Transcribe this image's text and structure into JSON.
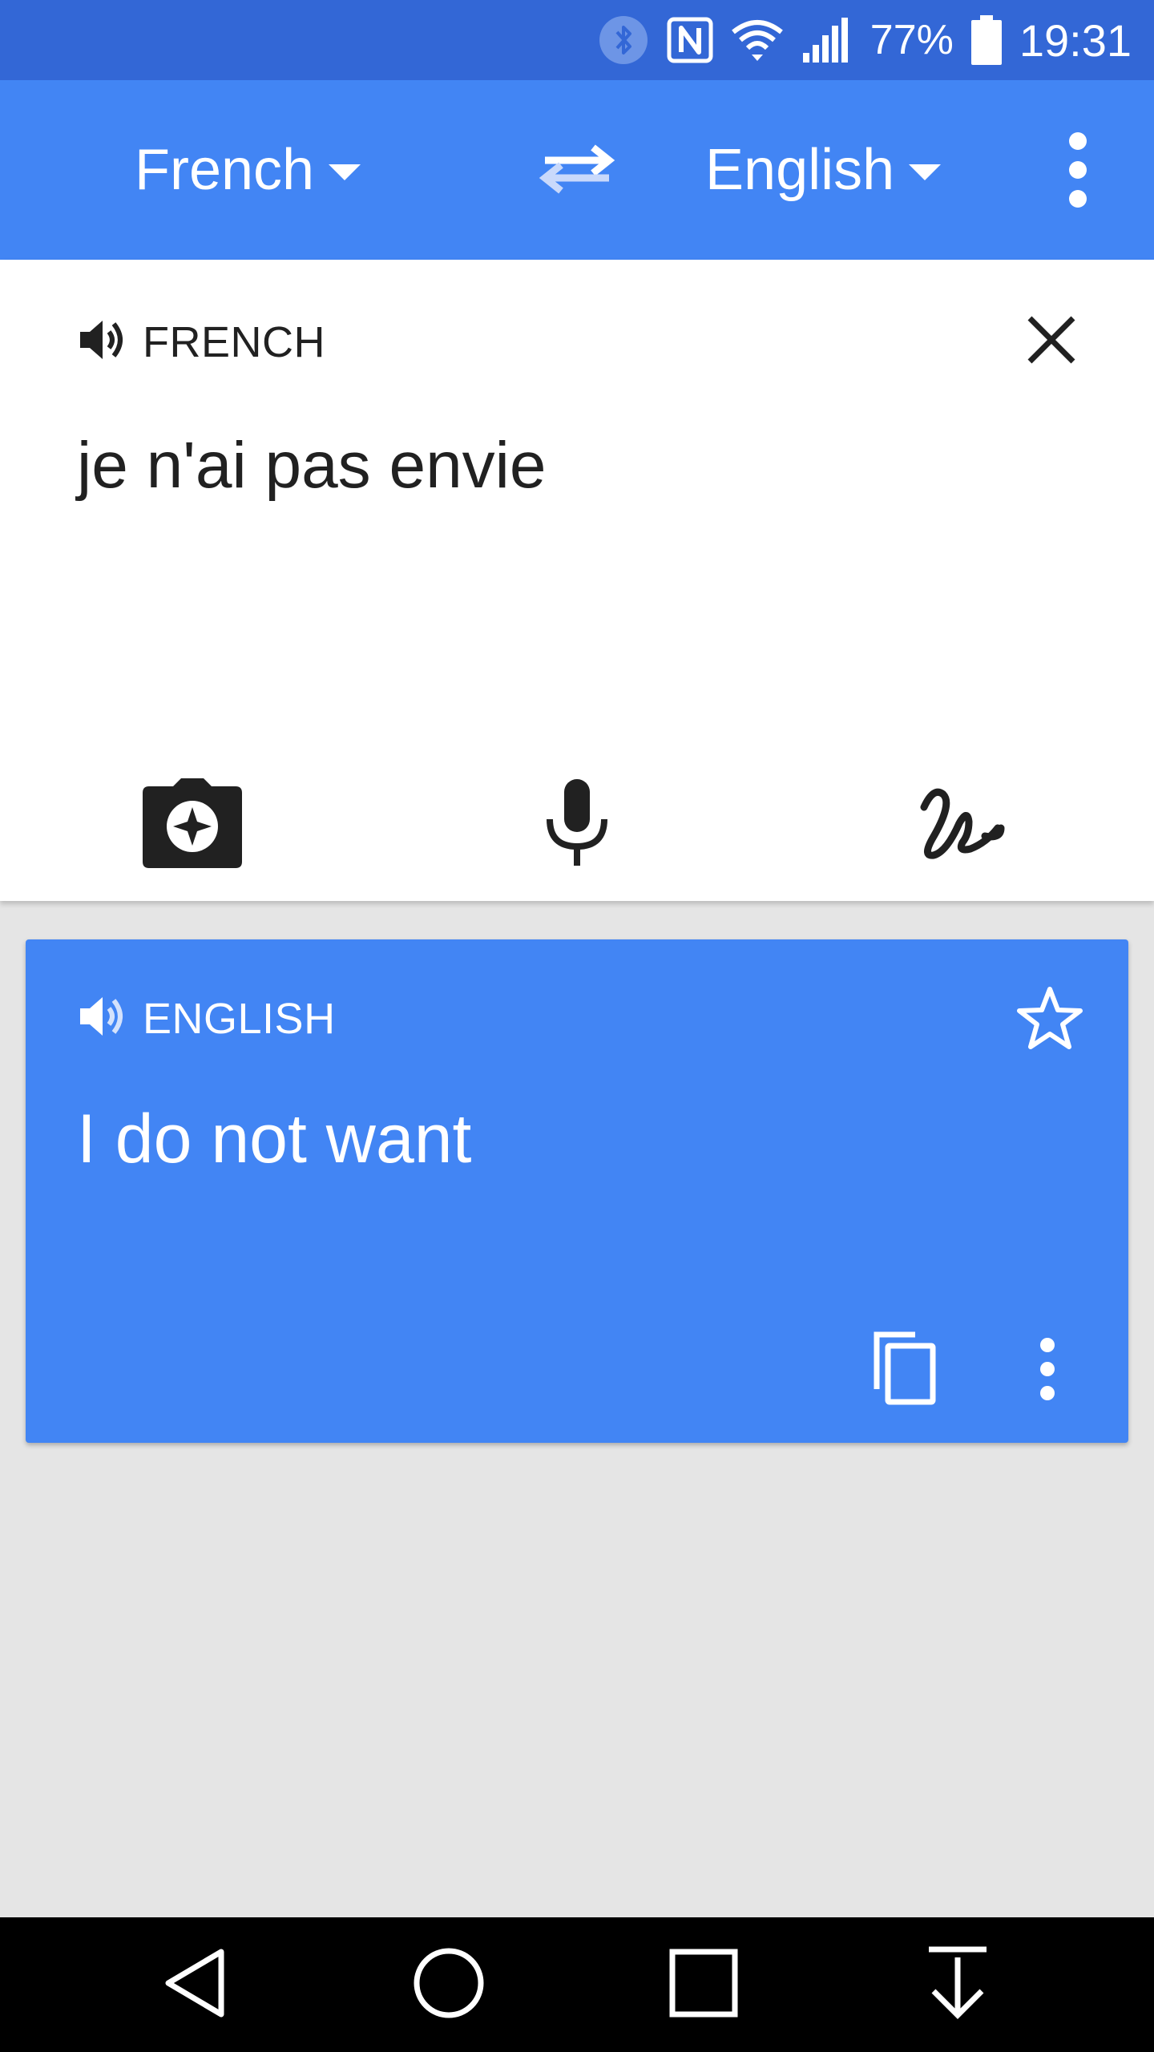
{
  "status_bar": {
    "battery_percent": "77%",
    "time": "19:31",
    "icons": [
      "bluetooth-icon",
      "nfc-icon",
      "wifi-icon",
      "signal-icon",
      "battery-icon"
    ]
  },
  "app_bar": {
    "source_language": "French",
    "target_language": "English",
    "icons": [
      "swap-languages-icon",
      "overflow-menu-icon"
    ]
  },
  "input_card": {
    "language_label": "FRENCH",
    "text": "je n'ai pas envie",
    "icons": [
      "speaker-icon",
      "close-icon",
      "camera-icon",
      "microphone-icon",
      "handwriting-icon"
    ]
  },
  "output_card": {
    "language_label": "ENGLISH",
    "text": "I do not want",
    "icons": [
      "speaker-icon",
      "star-icon",
      "copy-icon",
      "more-vert-icon"
    ]
  },
  "nav_bar": {
    "icons": [
      "back-icon",
      "home-icon",
      "recents-icon",
      "notification-pull-icon"
    ]
  },
  "colors": {
    "status_bar": "#3367d6",
    "primary": "#4285f4",
    "background": "#e5e5e5",
    "text_dark": "#212121"
  }
}
